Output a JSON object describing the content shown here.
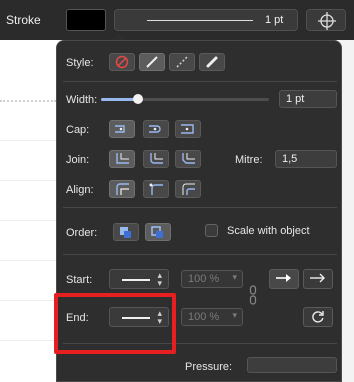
{
  "toolbar": {
    "stroke_label": "Stroke",
    "width_value": "1 pt"
  },
  "popover": {
    "style_label": "Style:",
    "width_label": "Width:",
    "width_value": "1 pt",
    "width_fraction": 0.22,
    "cap_label": "Cap:",
    "join_label": "Join:",
    "mitre_label": "Mitre:",
    "mitre_value": "1,5",
    "align_label": "Align:",
    "order_label": "Order:",
    "scale_label": "Scale with object",
    "start_label": "Start:",
    "start_scale": "100 %",
    "end_label": "End:",
    "end_scale": "100 %",
    "pressure_label": "Pressure:"
  },
  "colors": {
    "panel": "#2e2e2e",
    "accent": "#9ab8f0",
    "highlight": "#e62020"
  }
}
